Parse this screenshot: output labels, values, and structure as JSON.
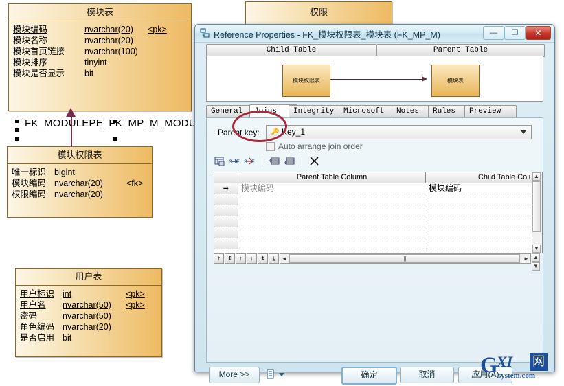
{
  "erd": {
    "entities": [
      {
        "name": "ent-module",
        "title": "模块表",
        "attributes": [
          {
            "name": "模块编码",
            "type": "nvarchar(20)",
            "key": "<pk>",
            "underline": true
          },
          {
            "name": "模块名称",
            "type": "nvarchar(20)",
            "key": "",
            "underline": false
          },
          {
            "name": "模块首页链接",
            "type": "nvarchar(100)",
            "key": "",
            "underline": false
          },
          {
            "name": "模块排序",
            "type": "tinyint",
            "key": "",
            "underline": false
          },
          {
            "name": "模块是否显示",
            "type": "bit",
            "key": "",
            "underline": false
          }
        ]
      },
      {
        "name": "ent-mp",
        "title": "模块权限表",
        "attributes": [
          {
            "name": "唯一标识",
            "type": "bigint",
            "key": "",
            "underline": false
          },
          {
            "name": "模块编码",
            "type": "nvarchar(20)",
            "key": "<fk>",
            "underline": false
          },
          {
            "name": "权限编码",
            "type": "nvarchar(20)",
            "key": "",
            "underline": false
          }
        ]
      },
      {
        "name": "ent-user",
        "title": "用户表",
        "attributes": [
          {
            "name": "用户标识",
            "type": "int",
            "key": "<pk>",
            "underline": true
          },
          {
            "name": "用户名",
            "type": "nvarchar(50)",
            "key": "<pk>",
            "underline": true
          },
          {
            "name": "密码",
            "type": "nvarchar(50)",
            "key": "",
            "underline": false
          },
          {
            "name": "角色编码",
            "type": "nvarchar(20)",
            "key": "",
            "underline": false
          },
          {
            "name": "是否启用",
            "type": "bit",
            "key": "",
            "underline": false
          }
        ]
      },
      {
        "name": "ent-right",
        "title": "权限",
        "attributes": []
      }
    ],
    "relationship_label": "FK_MODULEPE_FK_MP_M_MODULE"
  },
  "dialog": {
    "title": "Reference Properties - FK_模块权限表_模块表 (FK_MP_M)",
    "icon": "reference-icon",
    "window_buttons": {
      "minimize": "—",
      "maximize": "❐",
      "close": "✕"
    },
    "tables_preview": {
      "child_button": "Child Table",
      "parent_button": "Parent Table",
      "child_table": "模块权限表",
      "parent_table": "模块表"
    },
    "tabs": [
      {
        "label": "General",
        "active": false
      },
      {
        "label": "Joins",
        "active": true
      },
      {
        "label": "Integrity",
        "active": false
      },
      {
        "label": "Microsoft",
        "active": false
      },
      {
        "label": "Notes",
        "active": false
      },
      {
        "label": "Rules",
        "active": false
      },
      {
        "label": "Preview",
        "active": false
      }
    ],
    "joins": {
      "parent_key_label": "Parent key:",
      "parent_key_value": "Key_1",
      "parent_key_icon": "key-icon",
      "auto_arrange_label": "Auto arrange join order",
      "auto_arrange_checked": false,
      "toolbar_icons": [
        "properties-icon",
        "add-join-left-icon",
        "add-join-right-icon",
        "insert-row-icon",
        "append-row-icon",
        "delete-row-icon"
      ],
      "grid": {
        "columns": [
          "",
          "Parent Table Column",
          "Child Table Column"
        ],
        "rows": [
          {
            "marker": "➡",
            "parent_column": "模块编码",
            "child_column": "模块编码"
          },
          {
            "marker": "",
            "parent_column": "",
            "child_column": ""
          },
          {
            "marker": "",
            "parent_column": "",
            "child_column": ""
          },
          {
            "marker": "",
            "parent_column": "",
            "child_column": ""
          },
          {
            "marker": "",
            "parent_column": "",
            "child_column": ""
          },
          {
            "marker": "",
            "parent_column": "",
            "child_column": ""
          }
        ]
      },
      "nav_buttons": [
        "⤒",
        "⇞",
        "↑",
        "↓",
        "⇟",
        "⤓"
      ]
    },
    "footer": {
      "more": "More >>",
      "print_icon": "print-icon",
      "ok": "确定",
      "cancel": "取消",
      "apply": "应用(A)"
    }
  },
  "annotation": {
    "shape": "ellipse",
    "color": "#a8283c",
    "targets": "Joins tab"
  },
  "watermark": {
    "g": "G",
    "xi": "XI",
    "net": "网",
    "sub": "system.com"
  },
  "colors": {
    "entity_fill_light": "#fdf6e6",
    "entity_fill_dark": "#eeba62",
    "entity_border": "#8a6a2a",
    "relationship": "#7a2a4a",
    "dialog_title": "#d6ecf4",
    "annotation_red": "#a8283c",
    "watermark_blue": "#1b4f9c"
  }
}
